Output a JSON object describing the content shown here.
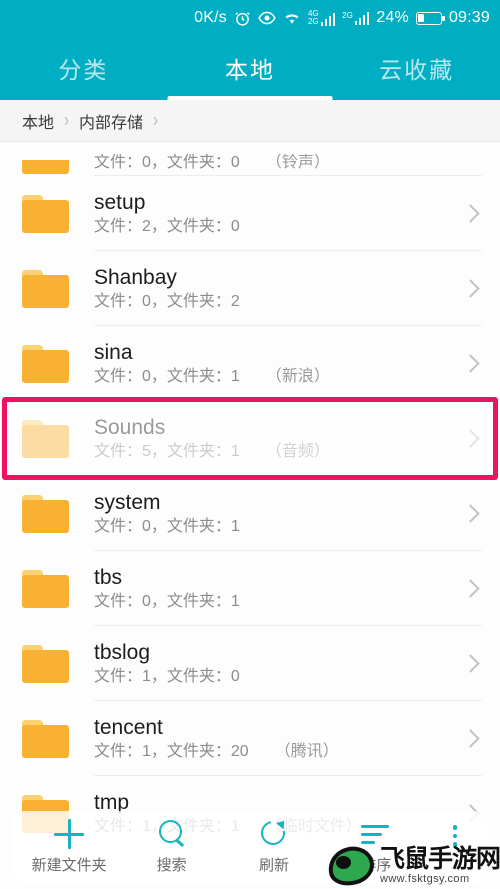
{
  "status_bar": {
    "network_speed": "0K/s",
    "icons": [
      "alarm-clock-icon",
      "eye-icon",
      "wifi-icon"
    ],
    "sim1_label_top": "4G",
    "sim1_label_bottom": "2G",
    "sim2_label": "2G",
    "battery_percent": "24%",
    "time": "09:39",
    "background_color": "#00AEC4"
  },
  "tabs": {
    "items": [
      {
        "label": "分类",
        "active": false
      },
      {
        "label": "本地",
        "active": true
      },
      {
        "label": "云收藏",
        "active": false
      }
    ],
    "active_index": 1,
    "accent_color": "#00AEC4"
  },
  "breadcrumb": {
    "items": [
      "本地",
      "内部存储"
    ],
    "separator": "›"
  },
  "list": {
    "rows": [
      {
        "name": "",
        "files_label": "文件：0，文件夹：0",
        "alias": "（铃声）",
        "partial": true,
        "highlighted": false
      },
      {
        "name": "setup",
        "files_label": "文件：2，文件夹：0",
        "alias": "",
        "partial": false,
        "highlighted": false
      },
      {
        "name": "Shanbay",
        "files_label": "文件：0，文件夹：2",
        "alias": "",
        "partial": false,
        "highlighted": false
      },
      {
        "name": "sina",
        "files_label": "文件：0，文件夹：1",
        "alias": "（新浪）",
        "partial": false,
        "highlighted": false
      },
      {
        "name": "Sounds",
        "files_label": "文件：5，文件夹：1",
        "alias": "（音频）",
        "partial": false,
        "highlighted": true
      },
      {
        "name": "system",
        "files_label": "文件：0，文件夹：1",
        "alias": "",
        "partial": false,
        "highlighted": false
      },
      {
        "name": "tbs",
        "files_label": "文件：0，文件夹：1",
        "alias": "",
        "partial": false,
        "highlighted": false
      },
      {
        "name": "tbslog",
        "files_label": "文件：1，文件夹：0",
        "alias": "",
        "partial": false,
        "highlighted": false
      },
      {
        "name": "tencent",
        "files_label": "文件：1，文件夹：20",
        "alias": "（腾讯）",
        "partial": false,
        "highlighted": false
      },
      {
        "name": "tmp",
        "files_label": "文件：1，文件夹：1",
        "alias": "（临时文件）",
        "partial": false,
        "highlighted": false
      }
    ],
    "folder_color": "#F8B133",
    "highlight_color": "#F01262"
  },
  "toolbar": {
    "items": [
      {
        "label": "新建文件夹",
        "icon": "plus-icon"
      },
      {
        "label": "搜索",
        "icon": "search-icon"
      },
      {
        "label": "刷新",
        "icon": "refresh-icon"
      },
      {
        "label": "排序",
        "icon": "sort-icon"
      }
    ],
    "more_icon": "more-vertical-icon",
    "icon_color": "#17B4BE"
  },
  "watermark": {
    "title": "飞鼠手游网",
    "url": "www.fsktgsy.com"
  }
}
